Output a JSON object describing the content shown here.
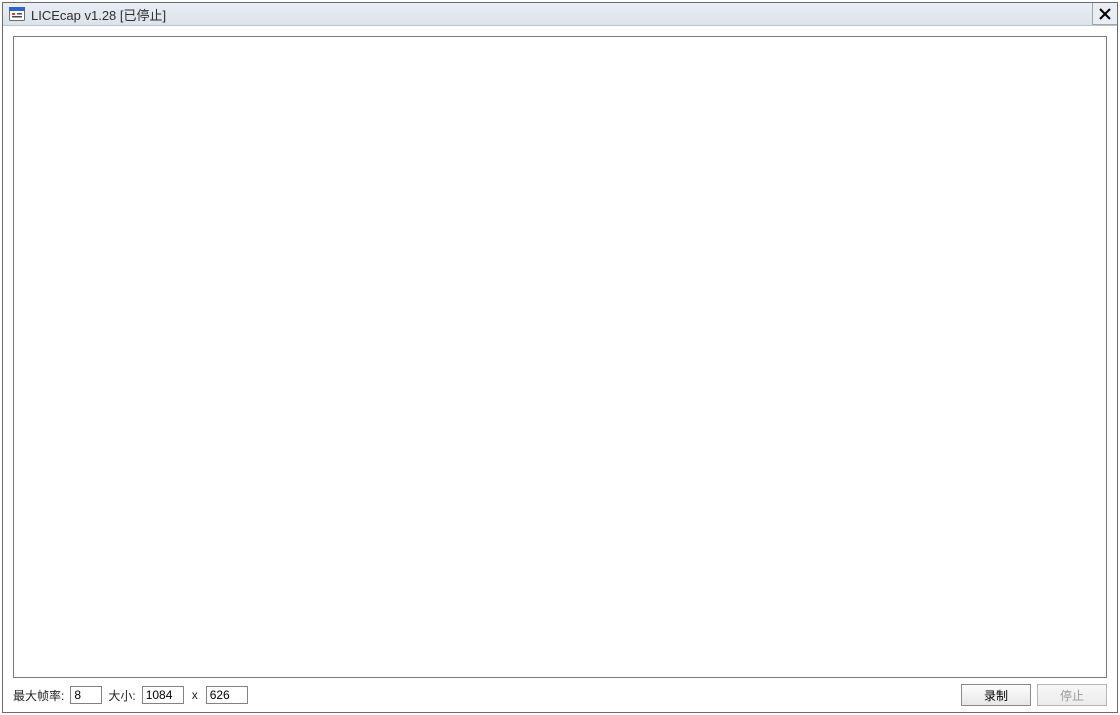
{
  "titlebar": {
    "title": "LICEcap v1.28 [已停止]",
    "icon_name": "licecap-app-icon"
  },
  "controls": {
    "close_label": "Close"
  },
  "bottom": {
    "max_fps_label": "最大帧率:",
    "max_fps_value": "8",
    "size_label": "大小:",
    "width_value": "1084",
    "height_value": "626",
    "size_sep": "x",
    "record_label": "录制",
    "stop_label": "停止",
    "stop_enabled": false
  }
}
